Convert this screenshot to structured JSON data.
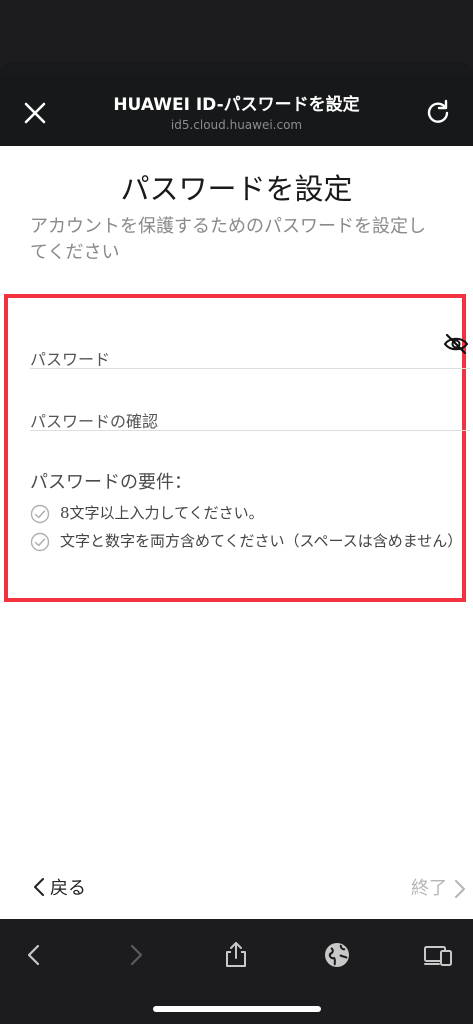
{
  "header": {
    "title": "HUAWEI ID-パスワードを設定",
    "url": "id5.cloud.huawei.com"
  },
  "page": {
    "title": "パスワードを設定",
    "description": "アカウントを保護するためのパスワードを設定し\nてください"
  },
  "form": {
    "password_placeholder": "パスワード",
    "confirm_placeholder": "パスワードの確認"
  },
  "requirements": {
    "title": "パスワードの要件：",
    "items": [
      "8文字以上入力してください。",
      "文字と数字を両方含めてください（スペースは含めません）"
    ]
  },
  "footer": {
    "back_label": "戻る",
    "done_label": "終了"
  },
  "colors": {
    "highlight_border": "#f2323f",
    "toolbar_bg": "#1c1c1e"
  },
  "icons": [
    "close-icon",
    "reload-icon",
    "eye-hidden-icon",
    "check-circle-icon",
    "chevron-left-icon",
    "chevron-right-icon",
    "share-icon",
    "globe-icon",
    "devices-icon"
  ]
}
